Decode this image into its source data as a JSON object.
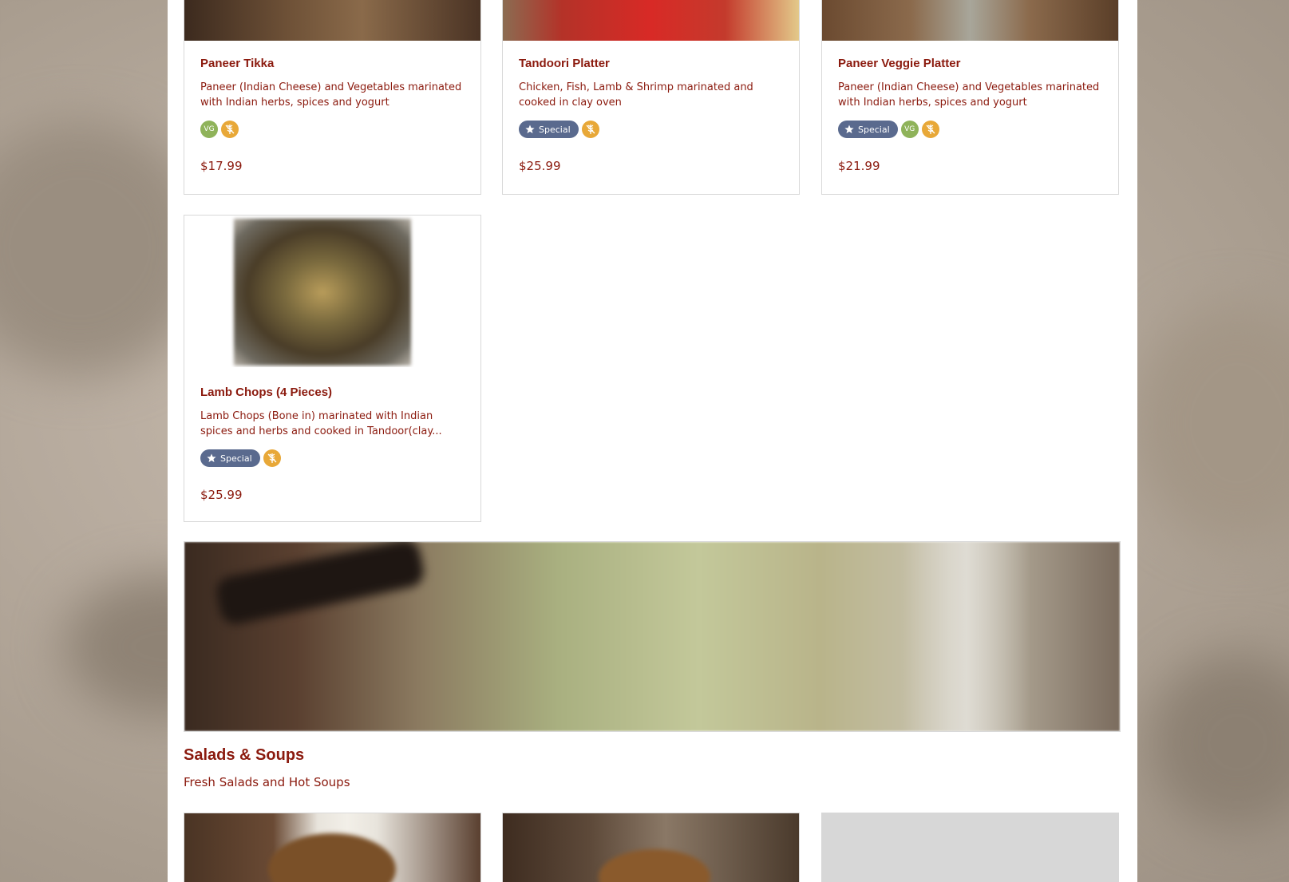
{
  "colors": {
    "accent": "#8b1a0e",
    "special_badge": "#5a6a8e",
    "vegan_badge": "#8fb35a",
    "gluten_free_badge": "#e8a838"
  },
  "menu_items": [
    {
      "title": "Paneer Tikka",
      "description": "Paneer (Indian Cheese) and Vegetables marinated with Indian herbs, spices and yogurt",
      "special_label": "",
      "vegan_label": "VG",
      "price": "$17.99"
    },
    {
      "title": "Tandoori Platter",
      "description": "Chicken, Fish, Lamb & Shrimp marinated and cooked in clay oven",
      "special_label": "Special",
      "price": "$25.99"
    },
    {
      "title": "Paneer Veggie Platter",
      "description": "Paneer (Indian Cheese) and Vegetables marinated with Indian herbs, spices and yogurt",
      "special_label": "Special",
      "vegan_label": "VG",
      "price": "$21.99"
    },
    {
      "title": "Lamb Chops (4 Pieces)",
      "description": "Lamb Chops (Bone in) marinated with Indian spices and herbs and cooked in Tandoor(clay...",
      "special_label": "Special",
      "price": "$25.99"
    }
  ],
  "section": {
    "title": "Salads & Soups",
    "subtitle": "Fresh Salads and Hot Soups"
  },
  "icons": {
    "special": "star-icon",
    "gluten_free": "wheat-icon",
    "vegan": "vg-badge"
  }
}
